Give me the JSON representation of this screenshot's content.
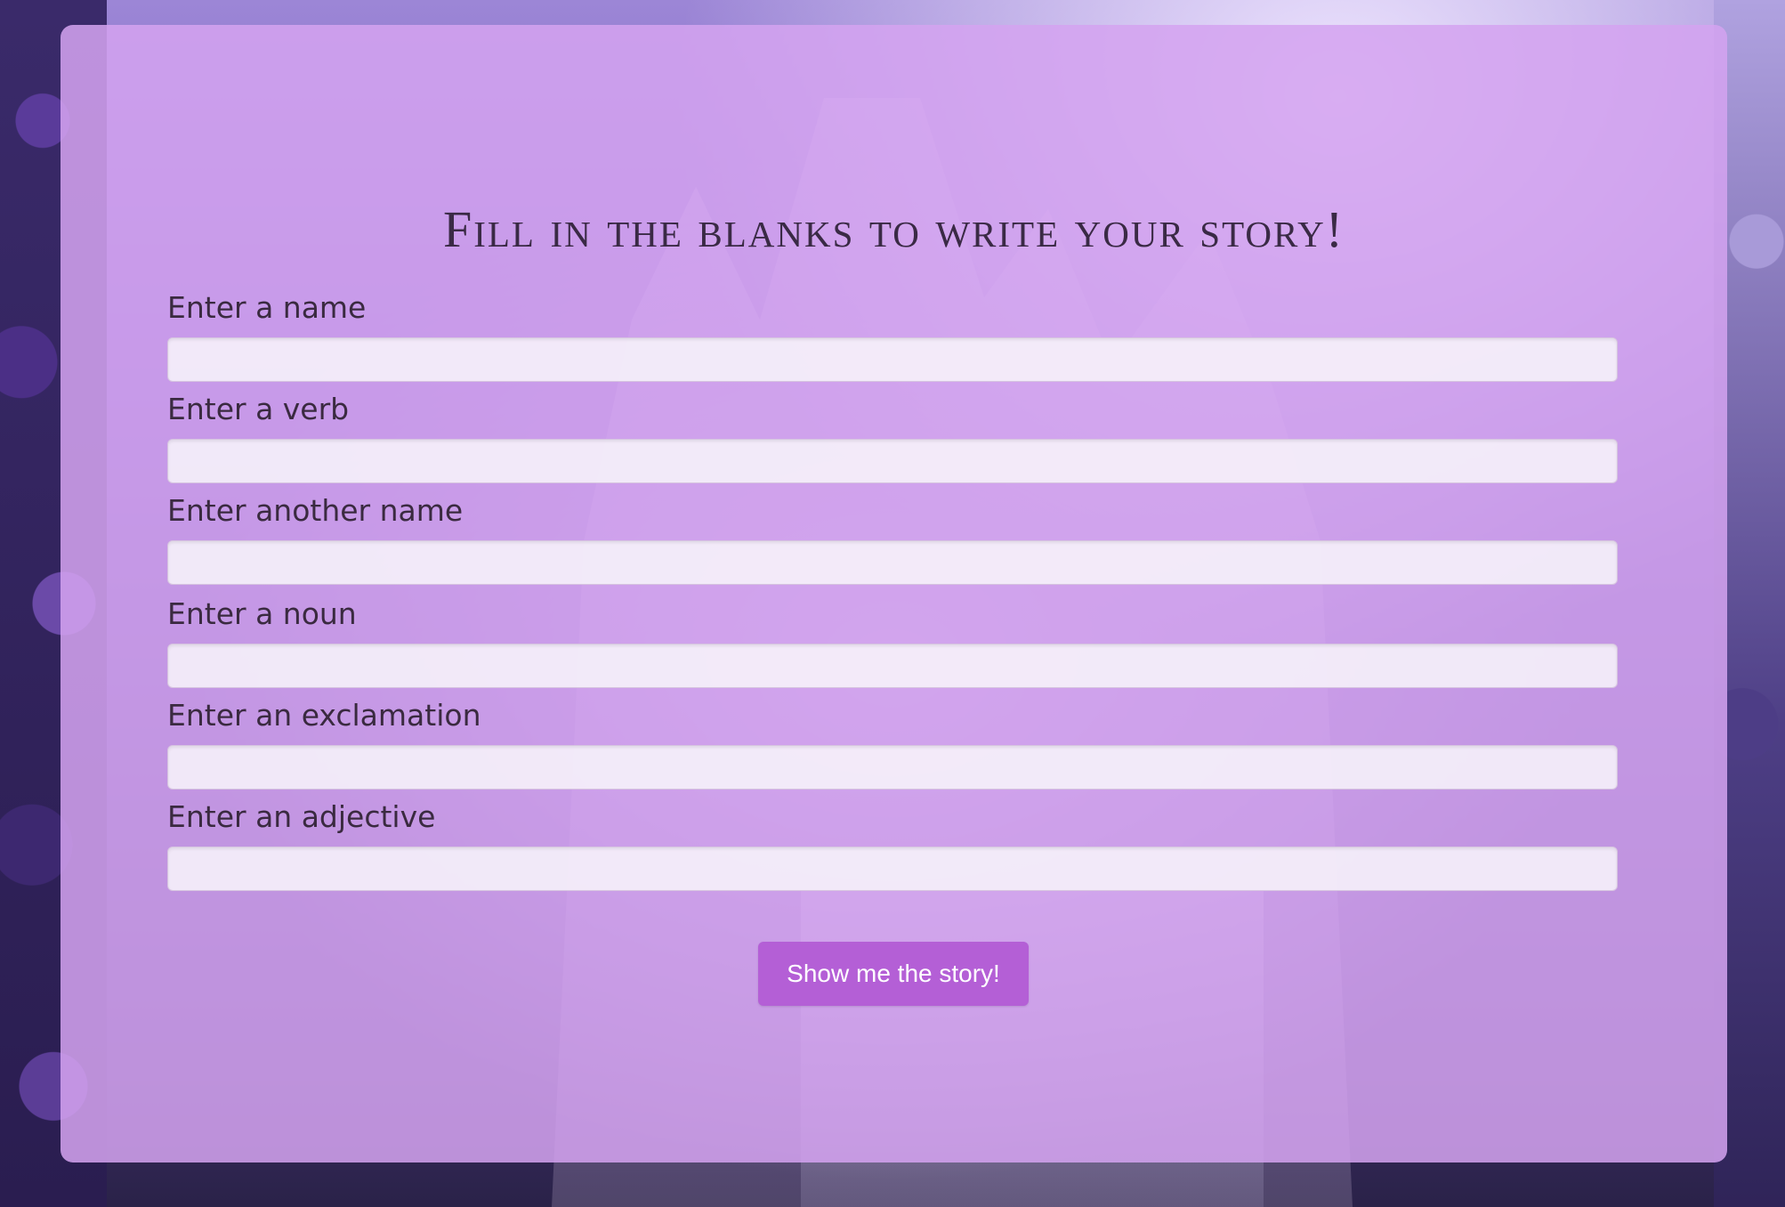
{
  "form": {
    "title": "Fill in the blanks to write your story!",
    "fields": [
      {
        "label": "Enter a name",
        "value": "",
        "placeholder": ""
      },
      {
        "label": "Enter a verb",
        "value": "",
        "placeholder": ""
      },
      {
        "label": "Enter another name",
        "value": "",
        "placeholder": ""
      },
      {
        "label": "Enter a noun",
        "value": "",
        "placeholder": ""
      },
      {
        "label": "Enter an exclamation",
        "value": "",
        "placeholder": ""
      },
      {
        "label": "Enter an adjective",
        "value": "",
        "placeholder": ""
      }
    ],
    "submit_label": "Show me the story!"
  },
  "colors": {
    "card_background": "#d4a3f0",
    "button_background": "#b45fd6",
    "title_text": "#3a2a45"
  }
}
